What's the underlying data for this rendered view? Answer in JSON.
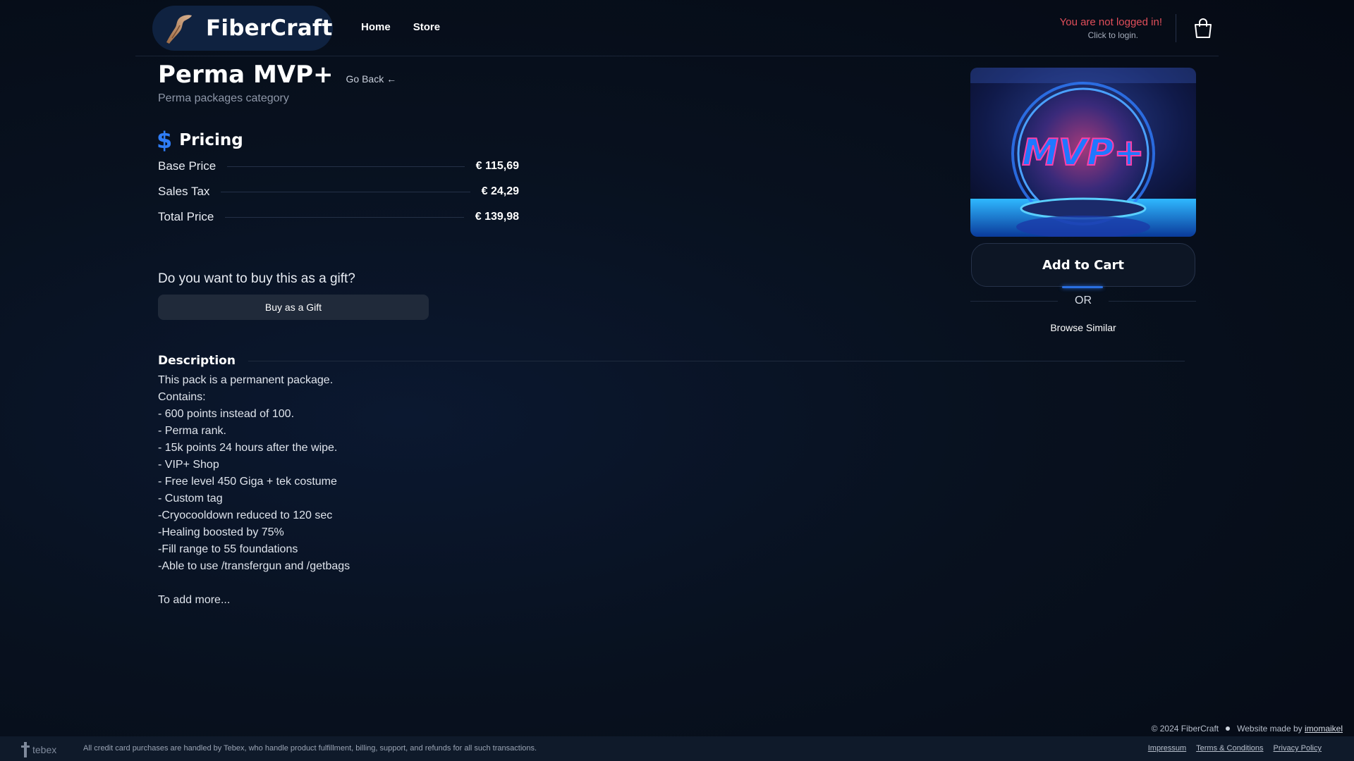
{
  "header": {
    "brand": "FiberCraft",
    "nav": [
      {
        "label": "Home"
      },
      {
        "label": "Store"
      }
    ],
    "login_warning": "You are not logged in!",
    "login_sub": "Click to login."
  },
  "product": {
    "title": "Perma MVP+",
    "go_back": "Go Back ←",
    "category": "Perma packages category",
    "image_text": "MVP+"
  },
  "pricing": {
    "heading": "Pricing",
    "symbol": "$",
    "rows": [
      {
        "label": "Base Price",
        "value": "€ 115,69"
      },
      {
        "label": "Sales Tax",
        "value": "€ 24,29"
      },
      {
        "label": "Total Price",
        "value": "€ 139,98"
      }
    ]
  },
  "gift": {
    "question": "Do you want to buy this as a gift?",
    "button": "Buy as a Gift"
  },
  "description": {
    "heading": "Description",
    "lines": [
      "This pack is a permanent package.",
      "Contains:",
      "- 600 points instead of 100.",
      "- Perma rank.",
      "- 15k points 24 hours after the wipe.",
      "- VIP+ Shop",
      "- Free level 450 Giga + tek costume",
      "- Custom tag",
      "-Cryocooldown reduced to 120 sec",
      "-Healing boosted by 75%",
      "-Fill range to 55 foundations",
      "-Able to use /transfergun and /getbags",
      "",
      "To add more..."
    ]
  },
  "actions": {
    "add_to_cart": "Add to Cart",
    "or": "OR",
    "browse_similar": "Browse Similar"
  },
  "footer": {
    "copyright": "© 2024 FiberCraft",
    "made_by_prefix": "Website made by",
    "made_by_name": "imomaikel",
    "tebex": "tebex",
    "notice": "All credit card purchases are handled by Tebex, who handle product fulfillment, billing, support, and refunds for all such transactions.",
    "links": [
      "Impressum",
      "Terms & Conditions",
      "Privacy Policy"
    ]
  },
  "colors": {
    "accent": "#2f7df6",
    "warning": "#e04e5a",
    "background": "#08111f"
  },
  "icons": {
    "brand": "stick-logo-icon",
    "cart": "shopping-bag-icon",
    "tebex": "tebex-logo-icon"
  }
}
